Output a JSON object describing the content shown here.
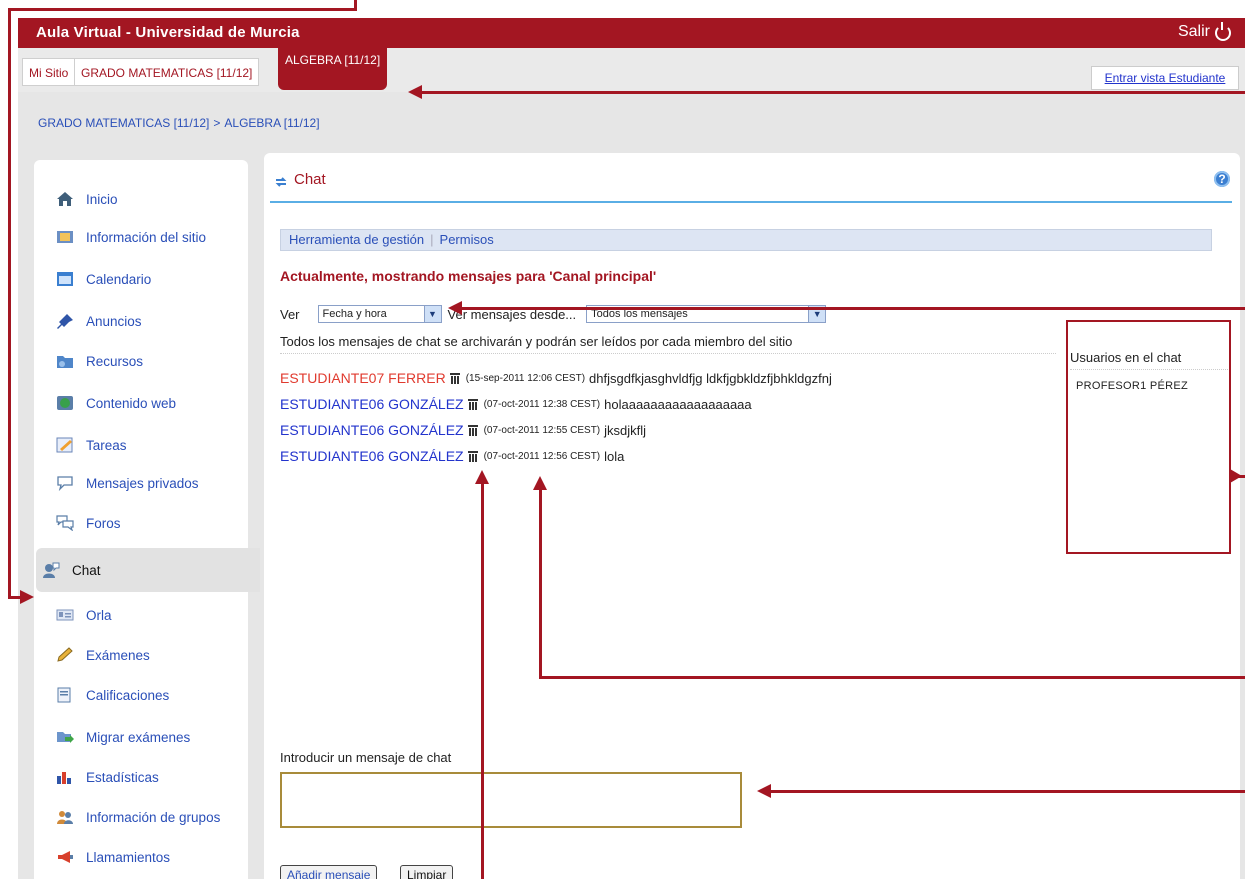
{
  "app": {
    "title": "Aula Virtual - Universidad de Murcia",
    "logout_label": "Salir",
    "brand_color": "#a31622"
  },
  "sitenav": {
    "tabs": [
      {
        "label": "Mi Sitio"
      },
      {
        "label": "GRADO MATEMATICAS [11/12]"
      },
      {
        "label": "ALGEBRA [11/12]",
        "active": true
      }
    ],
    "student_view_label": "Entrar vista Estudiante"
  },
  "breadcrumb": {
    "items": [
      "GRADO MATEMATICAS [11/12]",
      "ALGEBRA [11/12]"
    ],
    "separator": ">"
  },
  "sidebar": {
    "items": [
      {
        "label": "Inicio",
        "icon": "home-icon"
      },
      {
        "label": "Información del sitio",
        "icon": "info-icon"
      },
      {
        "label": "Calendario",
        "icon": "calendar-icon"
      },
      {
        "label": "Anuncios",
        "icon": "pin-icon"
      },
      {
        "label": "Recursos",
        "icon": "folder-icon"
      },
      {
        "label": "Contenido web",
        "icon": "globe-icon"
      },
      {
        "label": "Tareas",
        "icon": "task-icon"
      },
      {
        "label": "Mensajes privados",
        "icon": "speech-bubble-icon"
      },
      {
        "label": "Foros",
        "icon": "forum-icon"
      },
      {
        "label": "Chat",
        "icon": "chat-icon",
        "active": true
      },
      {
        "label": "Orla",
        "icon": "id-card-icon"
      },
      {
        "label": "Exámenes",
        "icon": "pencil-icon"
      },
      {
        "label": "Calificaciones",
        "icon": "grades-icon"
      },
      {
        "label": "Migrar exámenes",
        "icon": "migrate-icon"
      },
      {
        "label": "Estadísticas",
        "icon": "bar-chart-icon"
      },
      {
        "label": "Información de grupos",
        "icon": "group-icon"
      },
      {
        "label": "Llamamientos",
        "icon": "megaphone-icon"
      }
    ]
  },
  "chat": {
    "title": "Chat",
    "toolbar": {
      "manage_label": "Herramienta de gestión",
      "permissions_label": "Permisos"
    },
    "status_text": "Actualmente, mostrando mensajes para 'Canal principal'",
    "filters": {
      "view_label": "Ver",
      "view_selected": "Fecha y hora",
      "since_label": "Ver mensajes desde...",
      "since_selected": "Todos los mensajes"
    },
    "archive_note": "Todos los mensajes de chat se archivarán y podrán ser leídos por cada miembro del sitio",
    "messages": [
      {
        "author": "ESTUDIANTE07 FERRER",
        "time": "(15-sep-2011 12:06 CEST)",
        "text": "dhfjsgdfkjasghvldfjg ldkfjgbkldzfjbhkldgzfnj",
        "color": "#e03a2e"
      },
      {
        "author": "ESTUDIANTE06 GONZÁLEZ",
        "time": "(07-oct-2011 12:38 CEST)",
        "text": "holaaaaaaaaaaaaaaaaaa",
        "color": "#2233cc"
      },
      {
        "author": "ESTUDIANTE06 GONZÁLEZ",
        "time": "(07-oct-2011 12:55 CEST)",
        "text": "jksdjkflj",
        "color": "#2233cc"
      },
      {
        "author": "ESTUDIANTE06 GONZÁLEZ",
        "time": "(07-oct-2011 12:56 CEST)",
        "text": "lola",
        "color": "#2233cc"
      }
    ],
    "users_panel": {
      "heading": "Usuarios en el chat",
      "users": [
        "PROFESOR1 PÉREZ"
      ]
    },
    "input_label": "Introducir un mensaje de chat",
    "input_value": "",
    "add_button_label": "Añadir mensaje",
    "clear_button_label": "Limpiar"
  }
}
